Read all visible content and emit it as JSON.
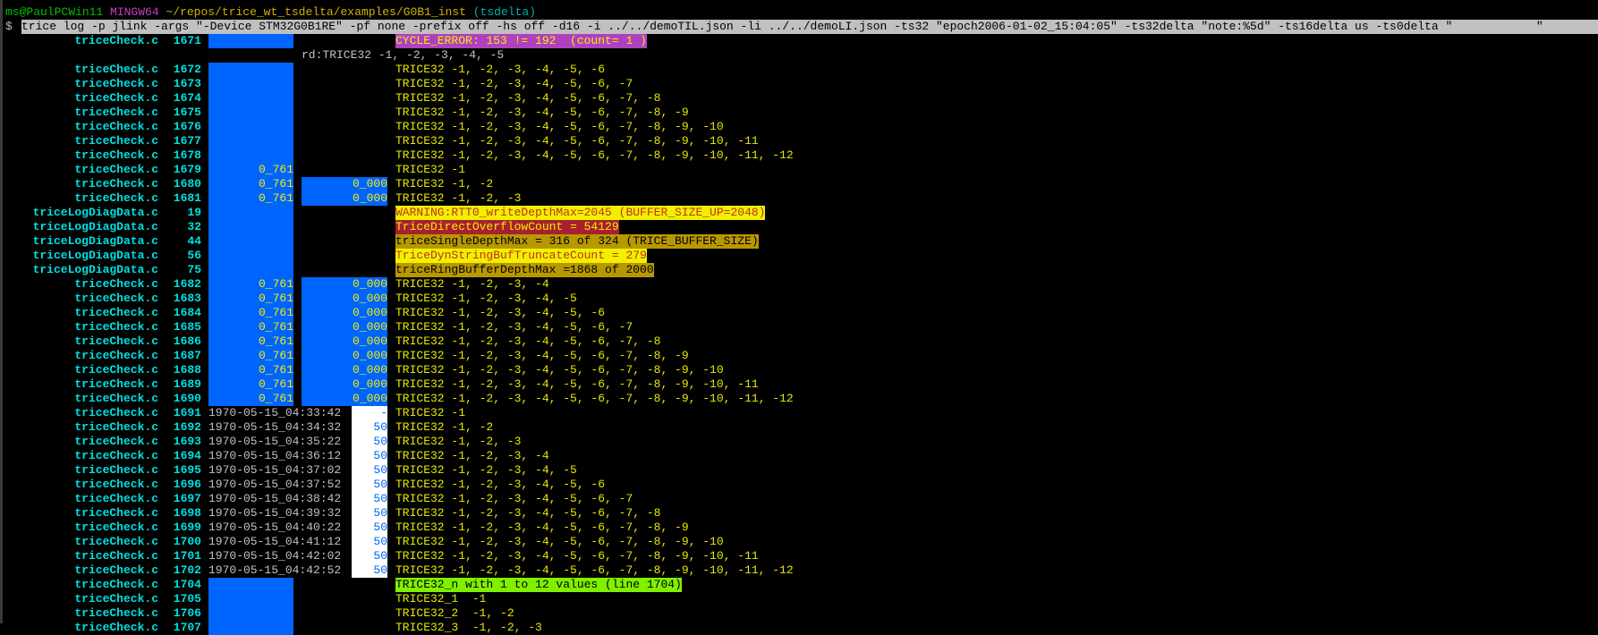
{
  "prompt": {
    "user_host": "ms@PaulPCWin11",
    "shell": "MINGW64",
    "path": "~/repos/trice_wt_tsdelta/examples/G0B1_inst",
    "branch": "(tsdelta)"
  },
  "command": {
    "symbol": "$",
    "text": "trice log -p jlink -args \"-Device STM32G0B1RE\" -pf none -prefix off -hs off -d16 -i ../../demoTIL.json -li ../../demoLI.json -ts32 \"epoch2006-01-02_15:04:05\" -ts32delta \"note:%5d\" -ts16delta us -ts0delta \"            \""
  },
  "colors": {
    "prompt_user": "#00c000",
    "prompt_shell": "#c040c0",
    "prompt_path": "#d0b000",
    "prompt_branch": "#00b0b0",
    "blue": "#0064ff",
    "cyan": "#00e0e0",
    "yellow": "#e8e800"
  },
  "styles": {
    "error": {
      "bg": "#b040c0",
      "fg": "#f0f000"
    },
    "warning": {
      "bg": "#f0f000",
      "fg": "#c03020"
    },
    "alert": {
      "bg": "#a82030",
      "fg": "#f0f000"
    },
    "info": {
      "bg": "#b89800",
      "fg": "#000000"
    },
    "notice": {
      "bg": "#80f000",
      "fg": "#000000"
    }
  },
  "rows": [
    {
      "file": "triceCheck.c",
      "line": "1671",
      "b1": "",
      "b2": null,
      "msg": "CYCLE_ERROR: 153 != 192  (count= 1 )",
      "style": "error"
    },
    {
      "raw": "rd:TRICE32 -1, -2, -3, -4, -5"
    },
    {
      "file": "triceCheck.c",
      "line": "1672",
      "b1": "",
      "b2": null,
      "msg": "TRICE32 -1, -2, -3, -4, -5, -6"
    },
    {
      "file": "triceCheck.c",
      "line": "1673",
      "b1": "",
      "b2": null,
      "msg": "TRICE32 -1, -2, -3, -4, -5, -6, -7"
    },
    {
      "file": "triceCheck.c",
      "line": "1674",
      "b1": "",
      "b2": null,
      "msg": "TRICE32 -1, -2, -3, -4, -5, -6, -7, -8"
    },
    {
      "file": "triceCheck.c",
      "line": "1675",
      "b1": "",
      "b2": null,
      "msg": "TRICE32 -1, -2, -3, -4, -5, -6, -7, -8, -9"
    },
    {
      "file": "triceCheck.c",
      "line": "1676",
      "b1": "",
      "b2": null,
      "msg": "TRICE32 -1, -2, -3, -4, -5, -6, -7, -8, -9, -10"
    },
    {
      "file": "triceCheck.c",
      "line": "1677",
      "b1": "",
      "b2": null,
      "msg": "TRICE32 -1, -2, -3, -4, -5, -6, -7, -8, -9, -10, -11"
    },
    {
      "file": "triceCheck.c",
      "line": "1678",
      "b1": "",
      "b2": null,
      "msg": "TRICE32 -1, -2, -3, -4, -5, -6, -7, -8, -9, -10, -11, -12"
    },
    {
      "file": "triceCheck.c",
      "line": "1679",
      "b1": "0_761",
      "b2": null,
      "msg": "TRICE32 -1"
    },
    {
      "file": "triceCheck.c",
      "line": "1680",
      "b1": "0_761",
      "b2": "0_000",
      "msg": "TRICE32 -1, -2"
    },
    {
      "file": "triceCheck.c",
      "line": "1681",
      "b1": "0_761",
      "b2": "0_000",
      "msg": "TRICE32 -1, -2, -3"
    },
    {
      "file": "triceLogDiagData.c",
      "line": "19",
      "b1": "",
      "b2": null,
      "msg": "WARNING:RTT0_writeDepthMax=2045 (BUFFER_SIZE_UP=2048)",
      "style": "warning"
    },
    {
      "file": "triceLogDiagData.c",
      "line": "32",
      "b1": "",
      "b2": null,
      "msg": "TriceDirectOverflowCount = 54129",
      "style": "alert"
    },
    {
      "file": "triceLogDiagData.c",
      "line": "44",
      "b1": "",
      "b2": null,
      "msg": "triceSingleDepthMax = 316 of 324 (TRICE_BUFFER_SIZE)",
      "style": "info"
    },
    {
      "file": "triceLogDiagData.c",
      "line": "56",
      "b1": "",
      "b2": null,
      "msg": "TriceDynStringBufTruncateCount = 279",
      "style": "warning"
    },
    {
      "file": "triceLogDiagData.c",
      "line": "75",
      "b1": "",
      "b2": null,
      "msg": "triceRingBufferDepthMax =1868 of 2000",
      "style": "info"
    },
    {
      "file": "triceCheck.c",
      "line": "1682",
      "b1": "0_761",
      "b2": "0_000",
      "msg": "TRICE32 -1, -2, -3, -4"
    },
    {
      "file": "triceCheck.c",
      "line": "1683",
      "b1": "0_761",
      "b2": "0_000",
      "msg": "TRICE32 -1, -2, -3, -4, -5"
    },
    {
      "file": "triceCheck.c",
      "line": "1684",
      "b1": "0_761",
      "b2": "0_000",
      "msg": "TRICE32 -1, -2, -3, -4, -5, -6"
    },
    {
      "file": "triceCheck.c",
      "line": "1685",
      "b1": "0_761",
      "b2": "0_000",
      "msg": "TRICE32 -1, -2, -3, -4, -5, -6, -7"
    },
    {
      "file": "triceCheck.c",
      "line": "1686",
      "b1": "0_761",
      "b2": "0_000",
      "msg": "TRICE32 -1, -2, -3, -4, -5, -6, -7, -8"
    },
    {
      "file": "triceCheck.c",
      "line": "1687",
      "b1": "0_761",
      "b2": "0_000",
      "msg": "TRICE32 -1, -2, -3, -4, -5, -6, -7, -8, -9"
    },
    {
      "file": "triceCheck.c",
      "line": "1688",
      "b1": "0_761",
      "b2": "0_000",
      "msg": "TRICE32 -1, -2, -3, -4, -5, -6, -7, -8, -9, -10"
    },
    {
      "file": "triceCheck.c",
      "line": "1689",
      "b1": "0_761",
      "b2": "0_000",
      "msg": "TRICE32 -1, -2, -3, -4, -5, -6, -7, -8, -9, -10, -11"
    },
    {
      "file": "triceCheck.c",
      "line": "1690",
      "b1": "0_761",
      "b2": "0_000",
      "msg": "TRICE32 -1, -2, -3, -4, -5, -6, -7, -8, -9, -10, -11, -12"
    },
    {
      "file": "triceCheck.c",
      "line": "1691",
      "ts": "1970-05-15_04:33:42",
      "delta": "-",
      "msg": "TRICE32 -1"
    },
    {
      "file": "triceCheck.c",
      "line": "1692",
      "ts": "1970-05-15_04:34:32",
      "delta": "50",
      "msg": "TRICE32 -1, -2"
    },
    {
      "file": "triceCheck.c",
      "line": "1693",
      "ts": "1970-05-15_04:35:22",
      "delta": "50",
      "msg": "TRICE32 -1, -2, -3"
    },
    {
      "file": "triceCheck.c",
      "line": "1694",
      "ts": "1970-05-15_04:36:12",
      "delta": "50",
      "msg": "TRICE32 -1, -2, -3, -4"
    },
    {
      "file": "triceCheck.c",
      "line": "1695",
      "ts": "1970-05-15_04:37:02",
      "delta": "50",
      "msg": "TRICE32 -1, -2, -3, -4, -5"
    },
    {
      "file": "triceCheck.c",
      "line": "1696",
      "ts": "1970-05-15_04:37:52",
      "delta": "50",
      "msg": "TRICE32 -1, -2, -3, -4, -5, -6"
    },
    {
      "file": "triceCheck.c",
      "line": "1697",
      "ts": "1970-05-15_04:38:42",
      "delta": "50",
      "msg": "TRICE32 -1, -2, -3, -4, -5, -6, -7"
    },
    {
      "file": "triceCheck.c",
      "line": "1698",
      "ts": "1970-05-15_04:39:32",
      "delta": "50",
      "msg": "TRICE32 -1, -2, -3, -4, -5, -6, -7, -8"
    },
    {
      "file": "triceCheck.c",
      "line": "1699",
      "ts": "1970-05-15_04:40:22",
      "delta": "50",
      "msg": "TRICE32 -1, -2, -3, -4, -5, -6, -7, -8, -9"
    },
    {
      "file": "triceCheck.c",
      "line": "1700",
      "ts": "1970-05-15_04:41:12",
      "delta": "50",
      "msg": "TRICE32 -1, -2, -3, -4, -5, -6, -7, -8, -9, -10"
    },
    {
      "file": "triceCheck.c",
      "line": "1701",
      "ts": "1970-05-15_04:42:02",
      "delta": "50",
      "msg": "TRICE32 -1, -2, -3, -4, -5, -6, -7, -8, -9, -10, -11"
    },
    {
      "file": "triceCheck.c",
      "line": "1702",
      "ts": "1970-05-15_04:42:52",
      "delta": "50",
      "msg": "TRICE32 -1, -2, -3, -4, -5, -6, -7, -8, -9, -10, -11, -12"
    },
    {
      "file": "triceCheck.c",
      "line": "1704",
      "b1": "",
      "b2": null,
      "msg": "TRICE32_n with 1 to 12 values (line 1704)",
      "style": "notice"
    },
    {
      "file": "triceCheck.c",
      "line": "1705",
      "b1": "",
      "b2": null,
      "msg": "TRICE32_1  -1"
    },
    {
      "file": "triceCheck.c",
      "line": "1706",
      "b1": "",
      "b2": null,
      "msg": "TRICE32_2  -1, -2"
    },
    {
      "file": "triceCheck.c",
      "line": "1707",
      "b1": "",
      "b2": null,
      "msg": "TRICE32_3  -1, -2, -3"
    }
  ]
}
